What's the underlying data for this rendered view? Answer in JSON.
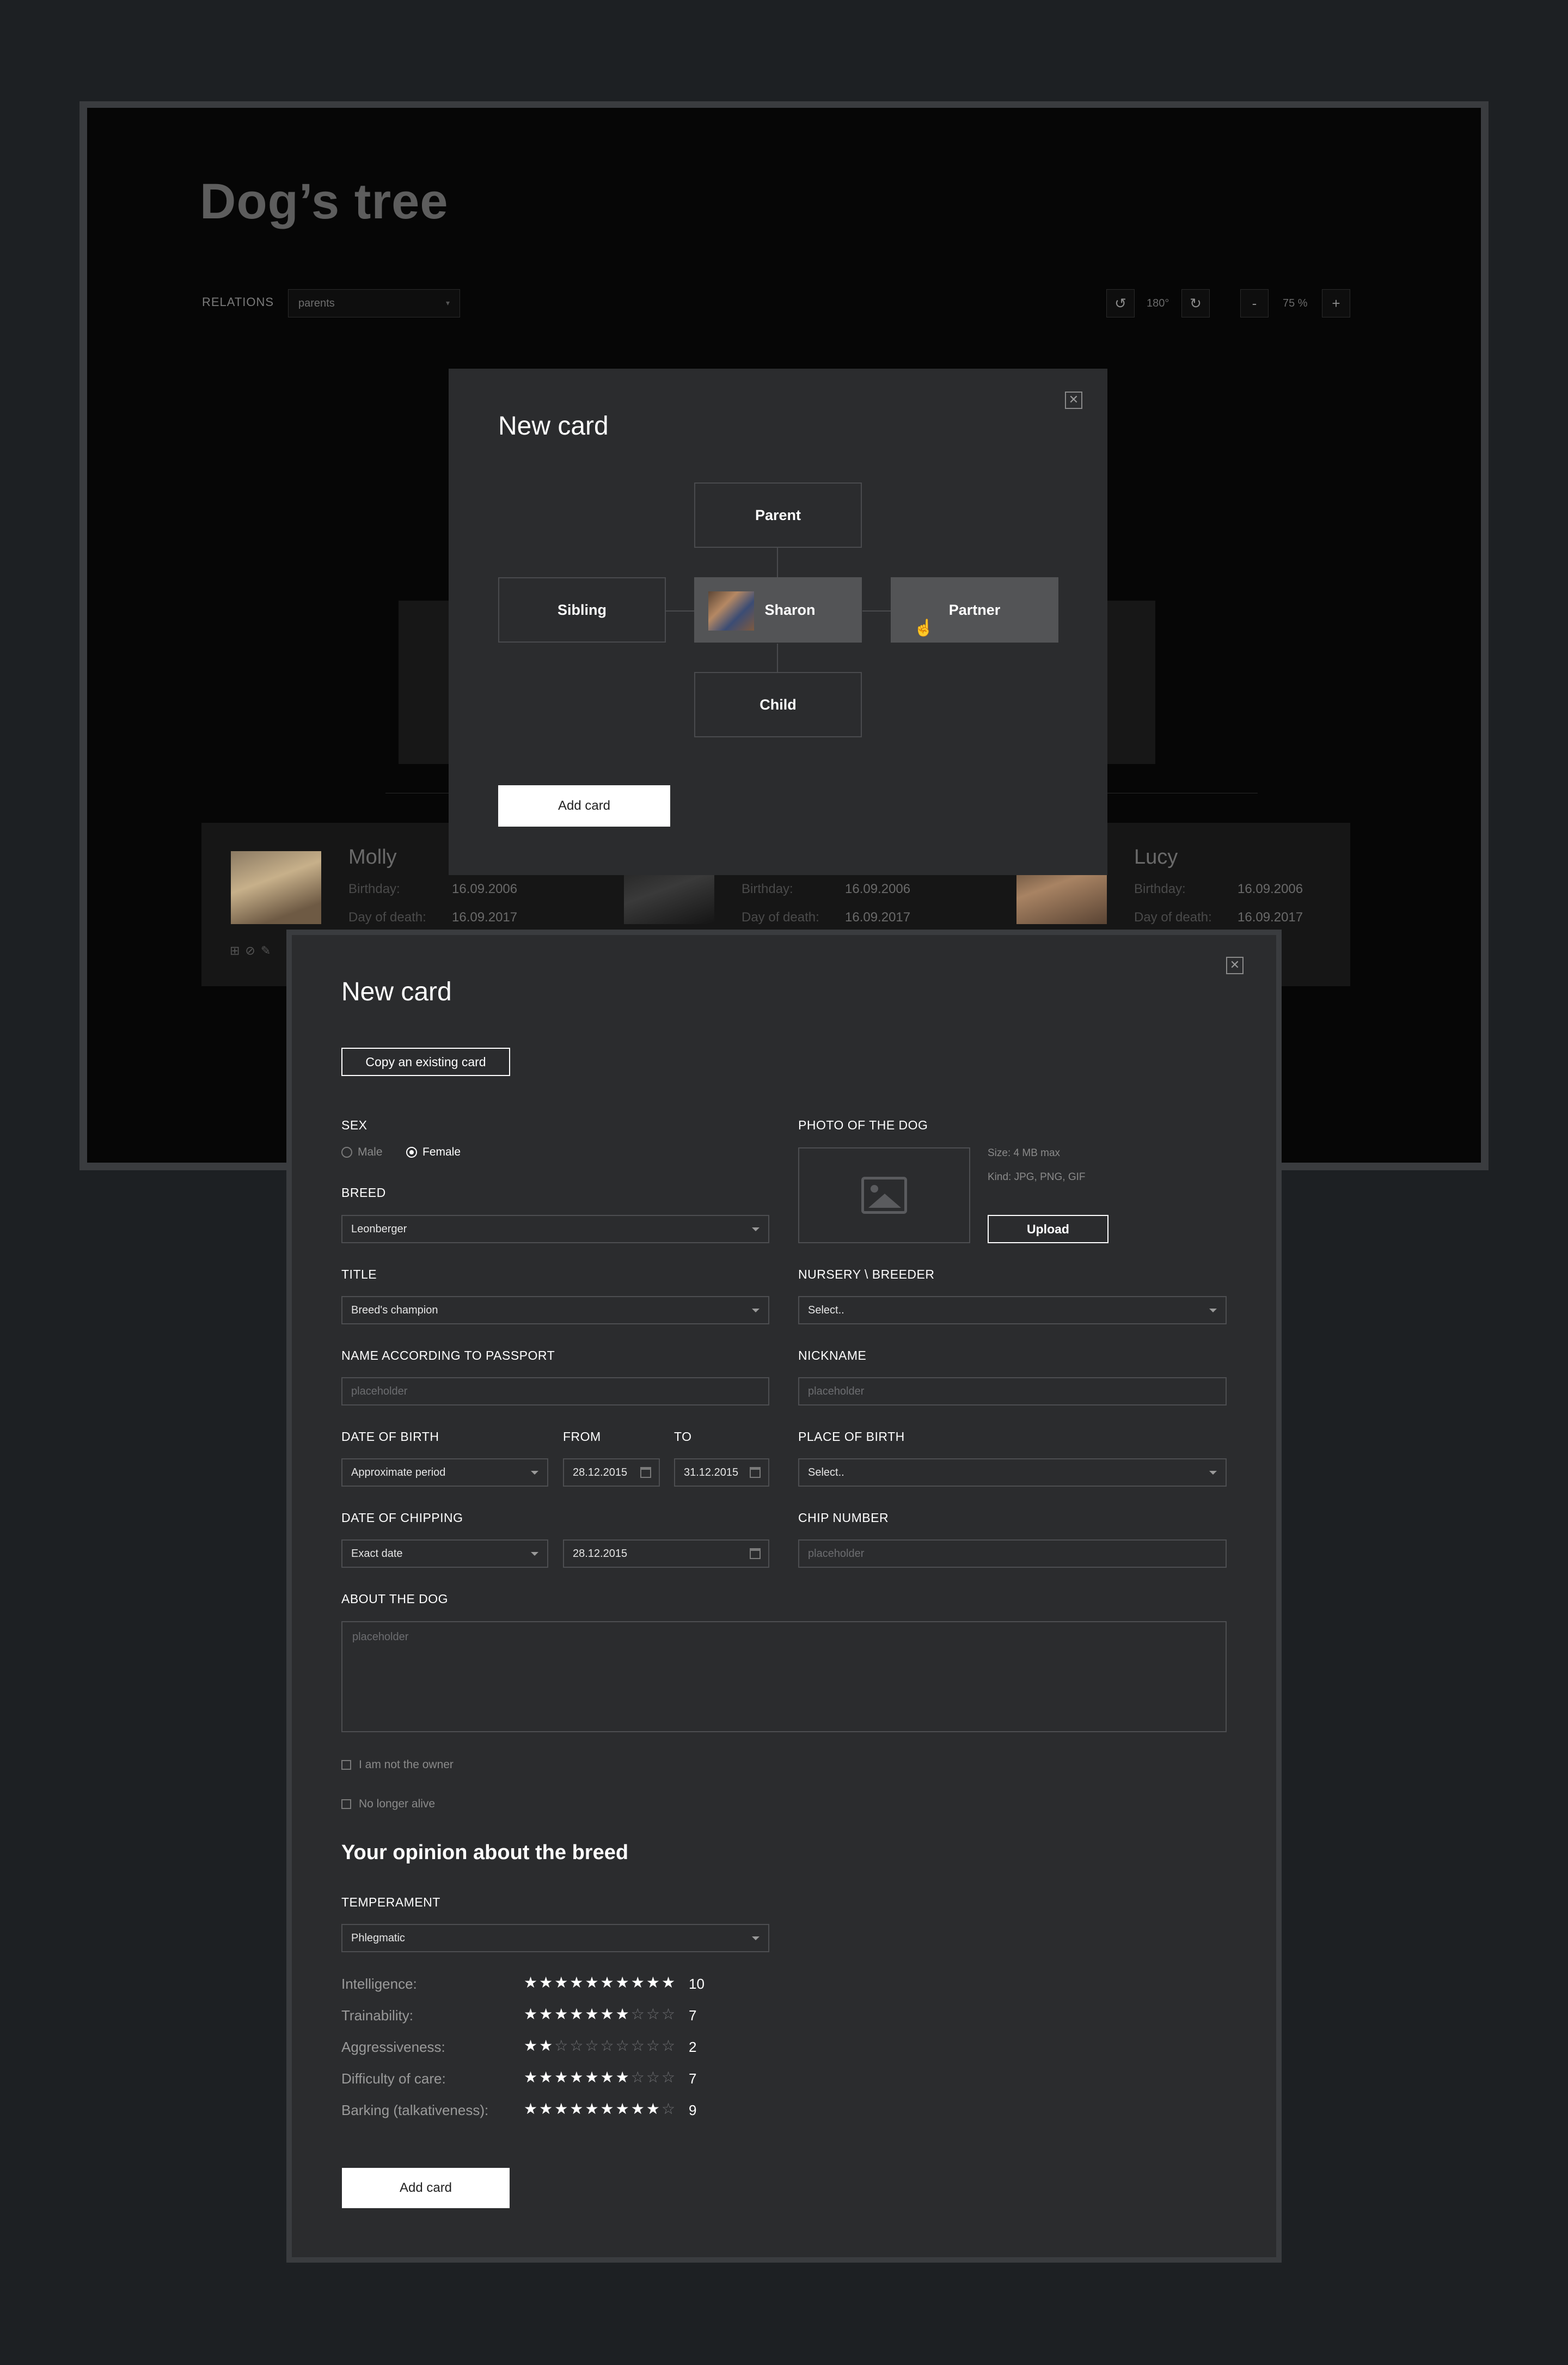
{
  "background": {
    "title": "Dog’s tree",
    "relations": {
      "label": "RELATIONS",
      "value": "parents"
    },
    "rotation": {
      "value": "180°"
    },
    "zoom": {
      "value": "75 %",
      "minus": "-",
      "plus": "+"
    },
    "cards": [
      {
        "name": "Molly",
        "birthday_label": "Birthday:",
        "birthday": "16.09.2006",
        "death_label": "Day of death:",
        "death": "16.09.2017"
      },
      {
        "name": "",
        "birthday_label": "Birthday:",
        "birthday": "16.09.2006",
        "death_label": "Day of death:",
        "death": "16.09.2017"
      },
      {
        "name": "Lucy",
        "birthday_label": "Birthday:",
        "birthday": "16.09.2006",
        "death_label": "Day of death:",
        "death": "16.09.2017"
      }
    ]
  },
  "modal1": {
    "title": "New card",
    "close": "✕",
    "parent": "Parent",
    "sibling": "Sibling",
    "current": "Sharon",
    "partner": "Partner",
    "child": "Child",
    "add_button": "Add card"
  },
  "modal2": {
    "title": "New card",
    "close": "✕",
    "copy_button": "Copy an existing card",
    "sex": {
      "label": "SEX",
      "options": [
        "Male",
        "Female"
      ],
      "selected": "Female"
    },
    "breed": {
      "label": "BREED",
      "value": "Leonberger"
    },
    "photo": {
      "label": "PHOTO OF THE DOG",
      "size": "Size: 4 MB max",
      "kind": "Kind: JPG, PNG, GIF",
      "upload": "Upload"
    },
    "title_field": {
      "label": "TITLE",
      "value": "Breed's champion"
    },
    "nursery": {
      "label": "NURSERY \\ BREEDER",
      "value": "Select.."
    },
    "passport_name": {
      "label": "NAME ACCORDING TO PASSPORT",
      "placeholder": "placeholder"
    },
    "nickname": {
      "label": "NICKNAME",
      "placeholder": "placeholder"
    },
    "dob": {
      "label": "DATE OF BIRTH",
      "value": "Approximate period",
      "from_label": "FROM",
      "from": "28.12.2015",
      "to_label": "TO",
      "to": "31.12.2015"
    },
    "place_of_birth": {
      "label": "PLACE OF BIRTH",
      "value": "Select.."
    },
    "chipping": {
      "label": "DATE OF CHIPPING",
      "value": "Exact date",
      "date": "28.12.2015"
    },
    "chip_number": {
      "label": "CHIP NUMBER",
      "placeholder": "placeholder"
    },
    "about": {
      "label": "ABOUT THE DOG",
      "placeholder": "placeholder"
    },
    "not_owner": "I am not the owner",
    "not_alive": "No longer alive",
    "opinion_title": "Your opinion about the breed",
    "temperament": {
      "label": "TEMPERAMENT",
      "value": "Phlegmatic"
    },
    "ratings": [
      {
        "label": "Intelligence:",
        "value": 10,
        "max": 10
      },
      {
        "label": "Trainability:",
        "value": 7,
        "max": 10
      },
      {
        "label": "Aggressiveness:",
        "value": 2,
        "max": 10
      },
      {
        "label": "Difficulty of care:",
        "value": 7,
        "max": 10
      },
      {
        "label": "Barking (talkativeness):",
        "value": 9,
        "max": 10
      }
    ],
    "add_button": "Add card"
  }
}
